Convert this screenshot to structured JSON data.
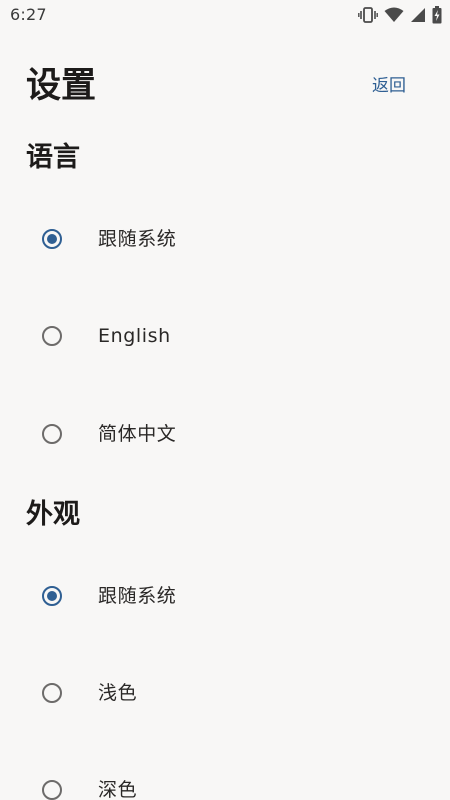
{
  "status_bar": {
    "time": "6:27",
    "icons": [
      "vibrate-icon",
      "wifi-icon",
      "cellular-signal-icon",
      "battery-charging-icon"
    ]
  },
  "header": {
    "title": "设置",
    "back_label": "返回"
  },
  "sections": {
    "language": {
      "title": "语言",
      "options": [
        {
          "label": "跟随系统",
          "selected": true
        },
        {
          "label": "English",
          "selected": false
        },
        {
          "label": "简体中文",
          "selected": false
        }
      ]
    },
    "appearance": {
      "title": "外观",
      "options": [
        {
          "label": "跟随系统",
          "selected": true
        },
        {
          "label": "浅色",
          "selected": false
        },
        {
          "label": "深色",
          "selected": false
        }
      ]
    }
  },
  "colors": {
    "accent": "#2f5f93",
    "background": "#f8f7f6",
    "text": "#1d1b1a",
    "radio_unselected": "#6d6b6a"
  }
}
